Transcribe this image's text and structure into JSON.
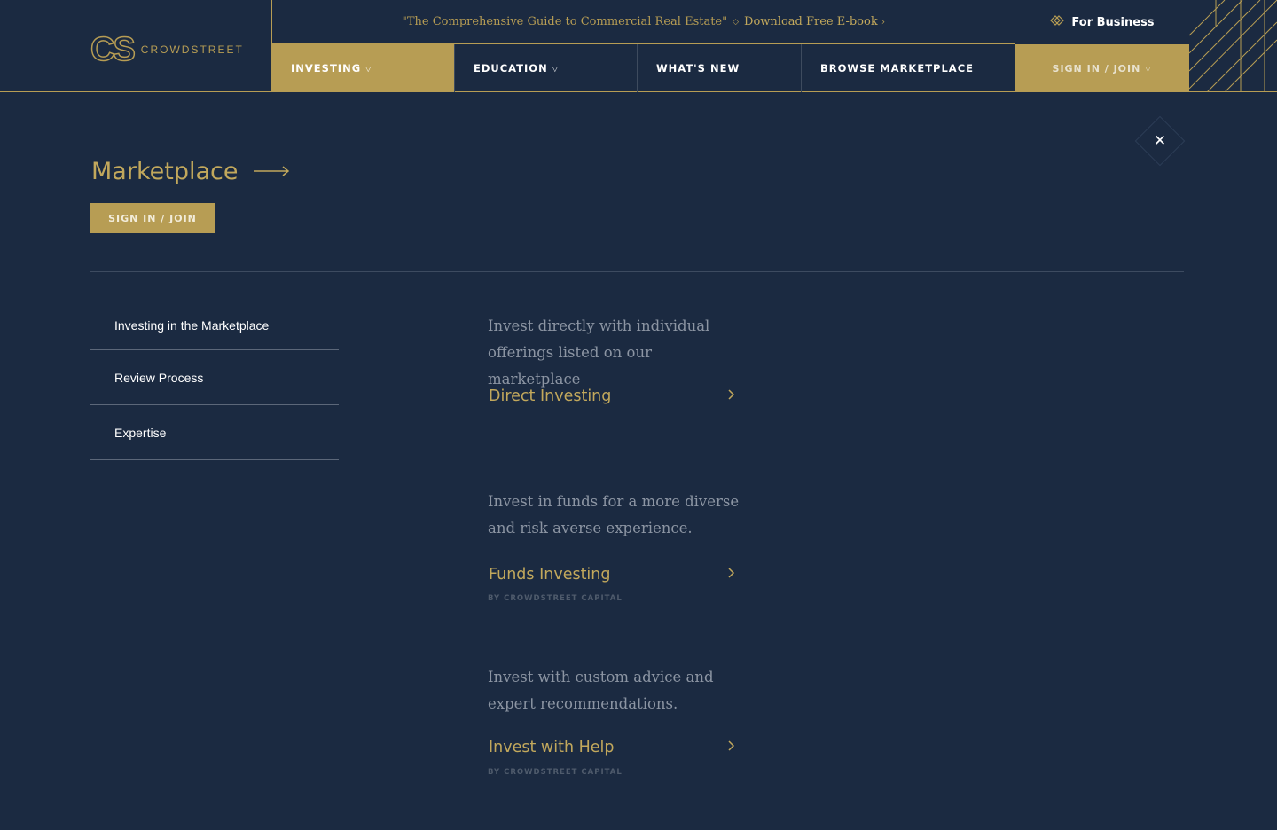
{
  "header": {
    "logo_mark": "CS",
    "logo_text": "CROWDSTREET",
    "promo_text": "\"The Comprehensive Guide to Commercial Real Estate\"",
    "promo_link": "Download Free E-book",
    "business_label": "For Business",
    "nav": [
      {
        "label": "INVESTING",
        "has_caret": true
      },
      {
        "label": "EDUCATION",
        "has_caret": true
      },
      {
        "label": "WHAT'S NEW",
        "has_caret": false
      },
      {
        "label": "BROWSE MARKETPLACE",
        "has_caret": false
      }
    ],
    "signin_label": "SIGN IN / JOIN"
  },
  "panel": {
    "title": "Marketplace",
    "signin_label": "SIGN IN / JOIN",
    "side_items": [
      {
        "label": "Investing in the Marketplace"
      },
      {
        "label": "Review Process"
      },
      {
        "label": "Expertise"
      }
    ],
    "offers": [
      {
        "description": "Invest directly with individual offerings listed on our marketplace",
        "link": "Direct Investing",
        "sub": ""
      },
      {
        "description": "Invest in funds for a more diverse and risk averse experience.",
        "link": "Funds Investing",
        "sub": "BY CROWDSTREET CAPITAL"
      },
      {
        "description": "Invest with custom advice and expert recommendations.",
        "link": "Invest with Help",
        "sub": "BY CROWDSTREET CAPITAL"
      }
    ]
  },
  "colors": {
    "background": "#1b2a41",
    "gold": "#b79d54",
    "gold_text": "#c2a85c",
    "muted_text": "#8c95a3"
  }
}
